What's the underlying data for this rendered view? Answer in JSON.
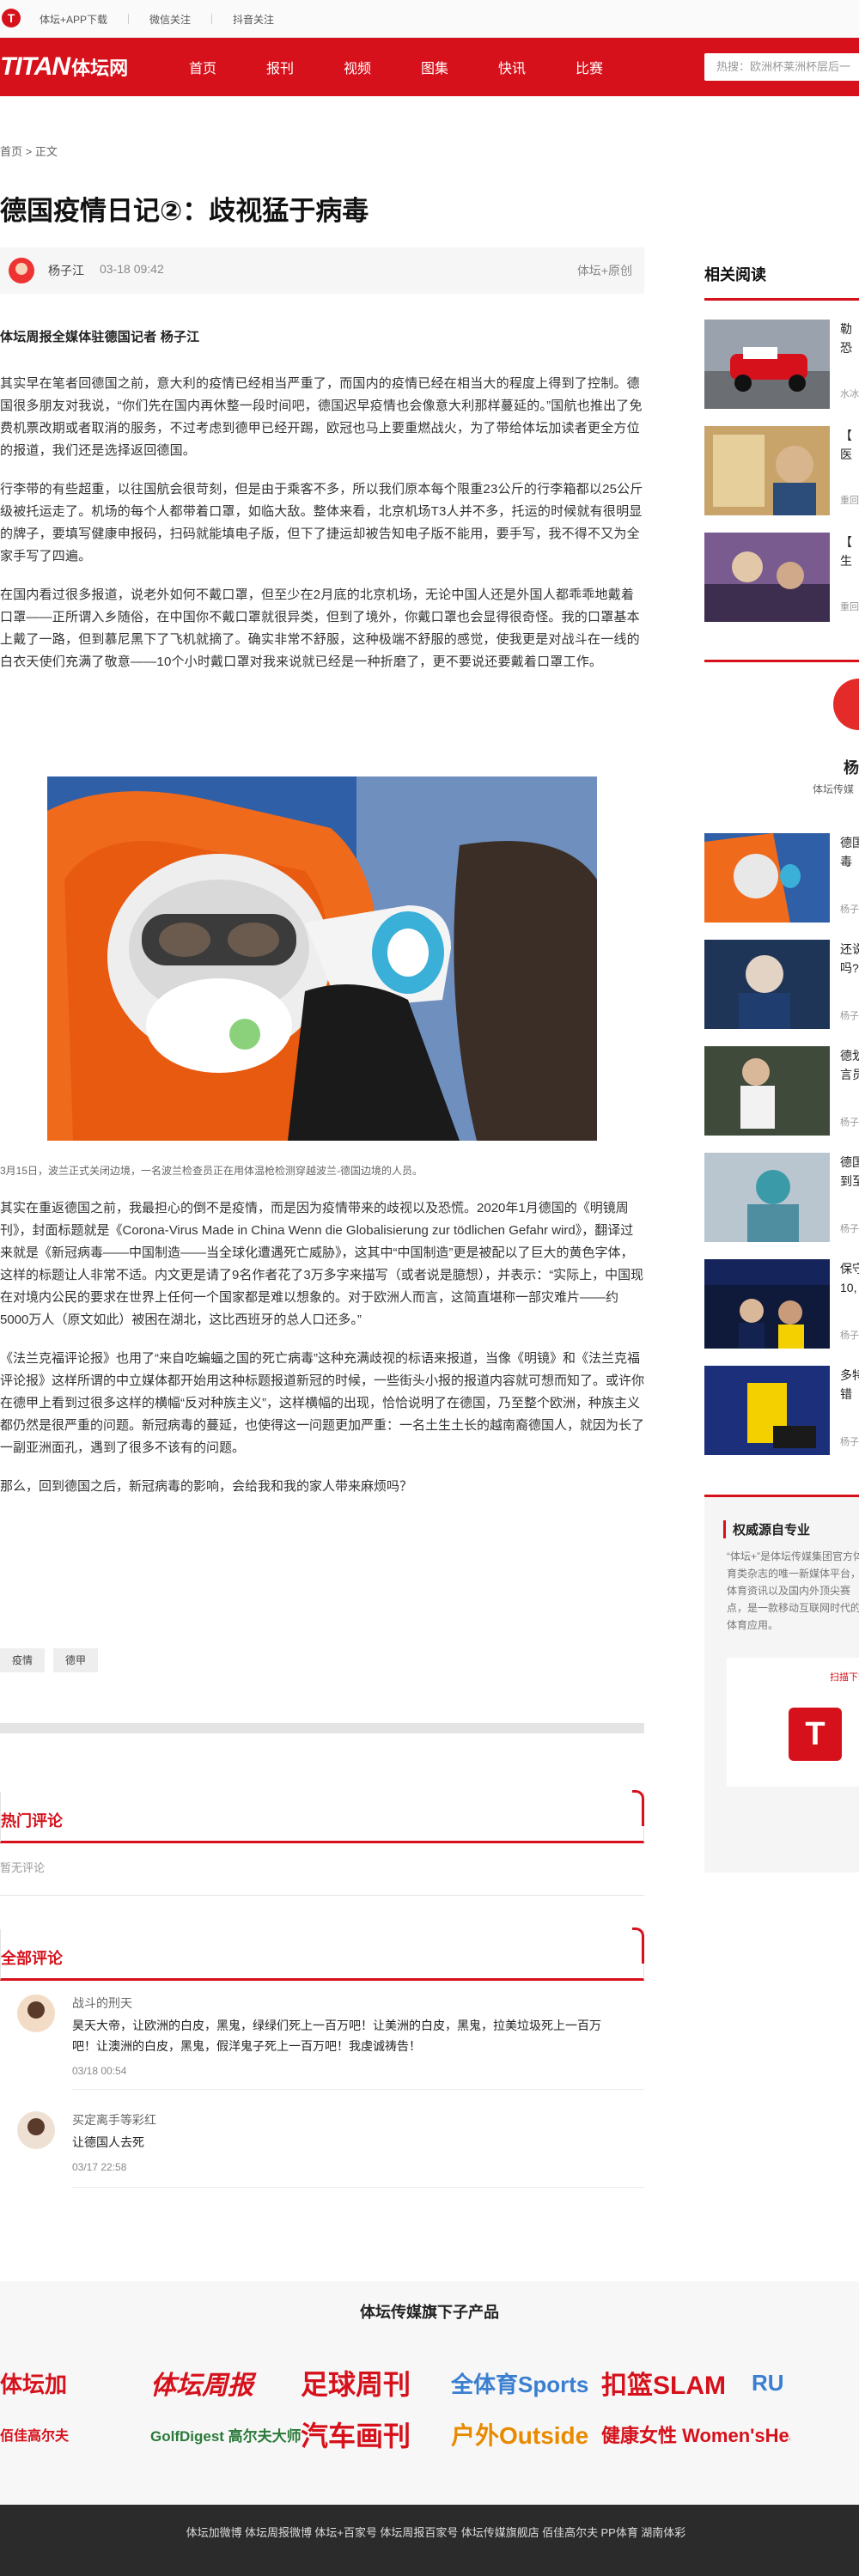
{
  "topbar": {
    "links": [
      "体坛+APP下载",
      "微信关注",
      "抖音关注"
    ]
  },
  "nav": {
    "brand_main": "TITAN",
    "brand_sub": "体坛网",
    "items": [
      "首页",
      "报刊",
      "视频",
      "图集",
      "快讯",
      "比赛"
    ],
    "search_placeholder": "热搜：欧洲杯莱洲杯层后一"
  },
  "breadcrumb": "首页 > 正文",
  "article": {
    "title": "德国疫情日记②：歧视猛于病毒",
    "author": "杨子江",
    "date": "03-18 09:42",
    "source": "体坛+原创",
    "lead": "体坛周报全媒体驻德国记者 杨子江",
    "paragraphs": [
      "其实早在笔者回德国之前，意大利的疫情已经相当严重了，而国内的疫情已经在相当大的程度上得到了控制。德国很多朋友对我说，“你们先在国内再休整一段时间吧，德国迟早疫情也会像意大利那样蔓延的。”国航也推出了免费机票改期或者取消的服务，不过考虑到德甲已经开踢，欧冠也马上要重燃战火，为了带给体坛加读者更全方位的报道，我们还是选择返回德国。",
      "行李带的有些超重，以往国航会很苛刻，但是由于乘客不多，所以我们原本每个限重23公斤的行李箱都以25公斤级被托运走了。机场的每个人都带着口罩，如临大敌。整体来看，北京机场T3人并不多，托运的时候就有很明显的牌子，要填写健康申报码，扫码就能填电子版，但下了捷运却被告知电子版不能用，要手写，我不得不又为全家手写了四遍。",
      "在国内看过很多报道，说老外如何不戴口罩，但至少在2月底的北京机场，无论中国人还是外国人都乖乖地戴着口罩——正所谓入乡随俗，在中国你不戴口罩就很异类，但到了境外，你戴口罩也会显得很奇怪。我的口罩基本上戴了一路，但到慕尼黑下了飞机就摘了。确实非常不舒服，这种极端不舒服的感觉，使我更是对战斗在一线的白衣天使们充满了敬意——10个小时戴口罩对我来说就已经是一种折磨了，更不要说还要戴着口罩工作。"
    ],
    "caption": "3月15日，波兰正式关闭边境，一名波兰检查员正在用体温枪检测穿越波兰-德国边境的人员。",
    "paragraphs2": [
      "其实在重返德国之前，我最担心的倒不是疫情，而是因为疫情带来的歧视以及恐慌。2020年1月德国的《明镜周刊》，封面标题就是《Corona-Virus Made in China Wenn die Globalisierung zur tödlichen Gefahr wird》，翻译过来就是《新冠病毒——中国制造——当全球化遭遇死亡威胁》，这其中“中国制造”更是被配以了巨大的黄色字体，这样的标题让人非常不适。内文更是请了9名作者花了3万多字来描写（或者说是臆想），并表示：“实际上，中国现在对境内公民的要求在世界上任何一个国家都是难以想象的。对于欧洲人而言，这简直堪称一部灾难片——约5000万人（原文如此）被困在湖北，这比西班牙的总人口还多。”",
      "《法兰克福评论报》也用了“来自吃蝙蝠之国的死亡病毒”这种充满歧视的标语来报道，当像《明镜》和《法兰克福评论报》这样所谓的中立媒体都开始用这种标题报道新冠的时候，一些街头小报的报道内容就可想而知了。或许你在德甲上看到过很多这样的横幅“反对种族主义”，这样横幅的出现，恰恰说明了在德国，乃至整个欧洲，种族主义都仍然是很严重的问题。新冠病毒的蔓延，也使得这一问题更加严重：一名土生土长的越南裔德国人，就因为长了一副亚洲面孔，遇到了很多不该有的问题。",
      "那么，回到德国之后，新冠病毒的影响，会给我和我的家人带来麻烦吗？"
    ],
    "tags": [
      "疫情",
      "德甲"
    ]
  },
  "comments": {
    "hot_label": "热门评论",
    "no_comments": "暂无评论",
    "all_label": "全部评论",
    "items": [
      {
        "user": "战斗的刑天",
        "text": "昊天大帝，让欧洲的白皮，黑鬼，绿绿们死上一百万吧！让美洲的白皮，黑鬼，拉美垃圾死上一百万吧！让澳洲的白皮，黑鬼，假洋鬼子死上一百万吧！我虔诚祷告！",
        "time": "03/18 00:54"
      },
      {
        "user": "买定离手等彩红",
        "text": "让德国人去死",
        "time": "03/17 22:58"
      }
    ]
  },
  "sidebar": {
    "related_label": "相关阅读",
    "related": [
      {
        "title": "勒",
        "subtitle": "恐",
        "src": "水冰"
      },
      {
        "title": "【",
        "subtitle": "医",
        "src": "重回"
      },
      {
        "title": "【",
        "subtitle": "生",
        "src": "重回"
      }
    ],
    "author_name": "杨",
    "author_org": "体坛传媒",
    "author_articles": [
      {
        "t1": "德国",
        "t2": "毒",
        "src": "杨子"
      },
      {
        "t1": "还说",
        "t2": "吗?",
        "src": "杨子"
      },
      {
        "t1": "德划",
        "t2": "言员",
        "src": "杨子"
      },
      {
        "t1": "德国",
        "t2": "到至",
        "src": "杨子"
      },
      {
        "t1": "保守",
        "t2": "10,",
        "src": "杨子"
      },
      {
        "t1": "多特",
        "t2": "错",
        "src": "杨子"
      }
    ],
    "authority_title": "权威源自专业",
    "authority_desc": "“体坛+”是体坛传媒集团官方体育类杂志的唯一新媒体平台，体育资讯以及国内外顶尖赛点，是一款移动互联网时代的体育应用。",
    "scan_label": "扫描下载",
    "app_logo_letter": "T"
  },
  "footer": {
    "title": "体坛传媒旗下子产品",
    "brands_row1": [
      "体坛加",
      "体坛周报",
      "足球周刊",
      "全体育Sports",
      "扣篮SLAM",
      "RU"
    ],
    "brands_row2": [
      "佰佳高尔夫",
      "GolfDigest 高尔夫大师",
      "汽车画刊",
      "户外Outside",
      "健康女性 Women'sHealth"
    ],
    "links": [
      "体坛加微博",
      "体坛周报微博",
      "体坛+百家号",
      "体坛周报百家号",
      "体坛传媒旗舰店",
      "佰佳高尔夫",
      "PP体育",
      "湖南体彩"
    ]
  },
  "colors": {
    "brand_red": "#d6111b"
  }
}
